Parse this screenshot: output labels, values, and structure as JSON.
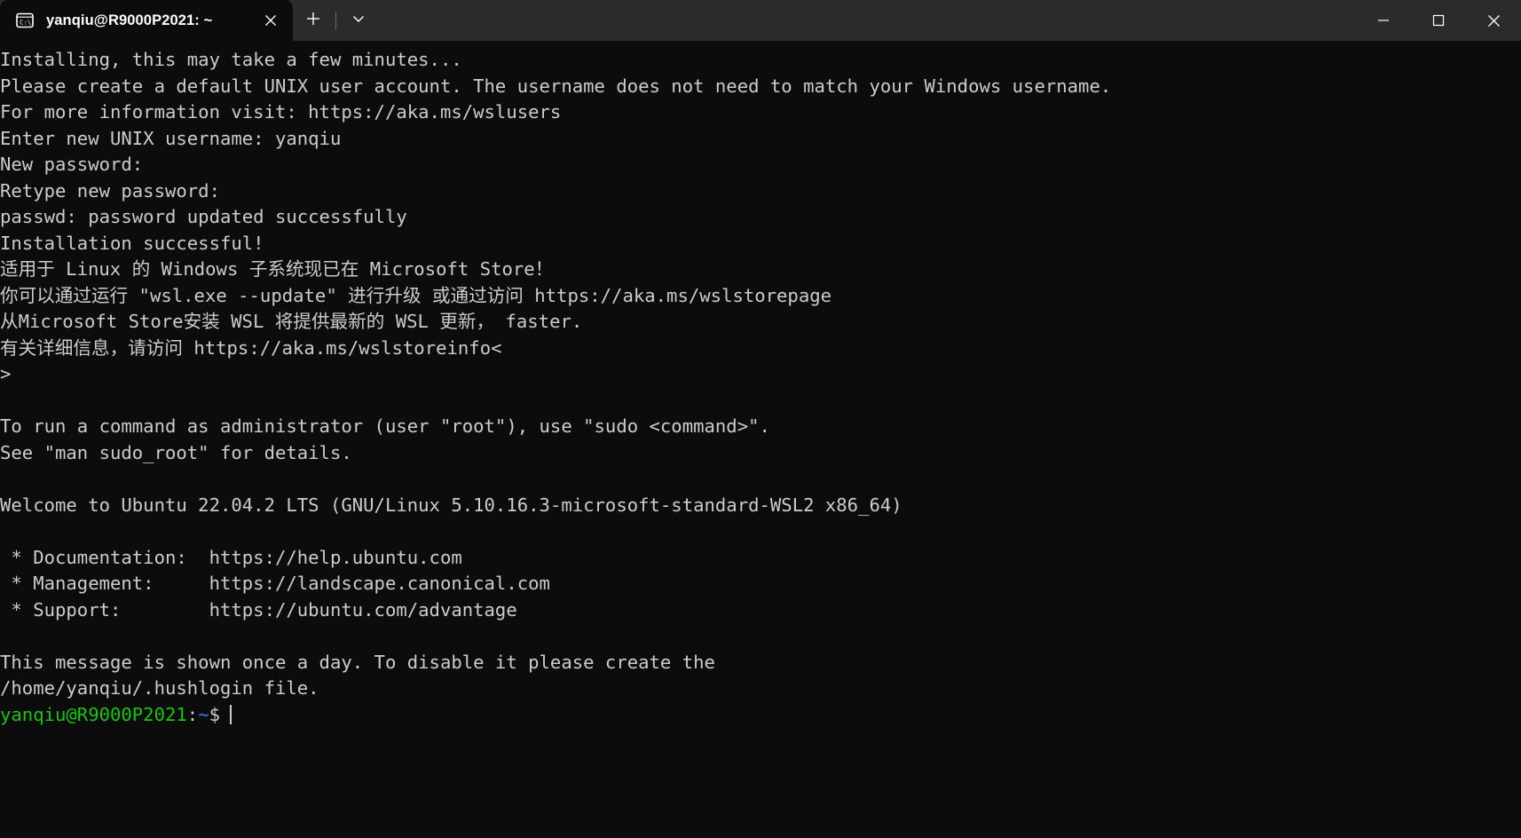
{
  "window": {
    "title": "yanqiu@R9000P2021: ~",
    "tab_icon": "console-cmd-icon",
    "close_tab_label": "×",
    "new_tab_label": "+",
    "dropdown_label": "⌄",
    "minimize_label": "—",
    "maximize_label": "□",
    "close_label": "✕"
  },
  "theme": {
    "titlebar_bg": "#2b2b2b",
    "terminal_bg": "#0c0c0c",
    "foreground": "#cccccc",
    "prompt_user_color": "#16c60c",
    "prompt_path_color": "#3b78ff"
  },
  "terminal": {
    "lines": [
      "Installing, this may take a few minutes...",
      "Please create a default UNIX user account. The username does not need to match your Windows username.",
      "For more information visit: https://aka.ms/wslusers",
      "Enter new UNIX username: yanqiu",
      "New password:",
      "Retype new password:",
      "passwd: password updated successfully",
      "Installation successful!",
      "适用于 Linux 的 Windows 子系统现已在 Microsoft Store！",
      "你可以通过运行 \"wsl.exe --update\" 进行升级 或通过访问 https://aka.ms/wslstorepage",
      "从Microsoft Store安装 WSL 将提供最新的 WSL 更新， faster.",
      "有关详细信息，请访问 https://aka.ms/wslstoreinfo<",
      ">",
      "",
      "To run a command as administrator (user \"root\"), use \"sudo <command>\".",
      "See \"man sudo_root\" for details.",
      "",
      "Welcome to Ubuntu 22.04.2 LTS (GNU/Linux 5.10.16.3-microsoft-standard-WSL2 x86_64)",
      "",
      " * Documentation:  https://help.ubuntu.com",
      " * Management:     https://landscape.canonical.com",
      " * Support:        https://ubuntu.com/advantage",
      "",
      "This message is shown once a day. To disable it please create the",
      "/home/yanqiu/.hushlogin file."
    ],
    "prompt": {
      "user_host": "yanqiu@R9000P2021",
      "colon": ":",
      "path": "~",
      "sigil": "$",
      "input": ""
    }
  }
}
